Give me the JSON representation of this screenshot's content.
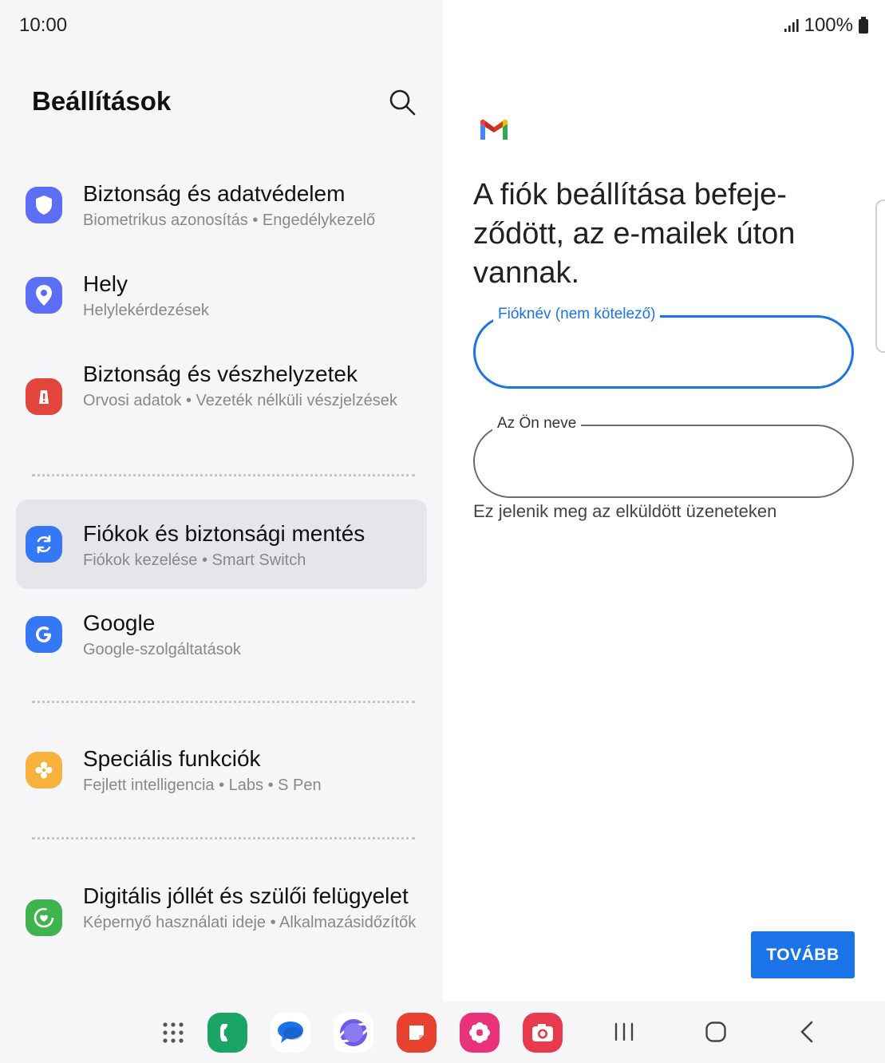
{
  "status": {
    "time": "10:00",
    "battery": "100%",
    "signal_icon": "signal-bars-icon",
    "battery_icon": "battery-full-icon"
  },
  "settings": {
    "title": "Beállítások",
    "search_icon": "search-icon",
    "items": [
      {
        "name": "Biztonság és adatvédelem",
        "sub": "Biometrikus azonosítás  •  Engedélykezelő",
        "icon": "shield-icon",
        "color": "#5b6ef5"
      },
      {
        "name": "Hely",
        "sub": "Helylekérdezések",
        "icon": "location-pin-icon",
        "color": "#5b6ef5"
      },
      {
        "name": "Biztonság és vészhelyzetek",
        "sub": "Orvosi adatok  •  Vezeték nélküli vészjelzések",
        "icon": "emergency-alert-icon",
        "color": "#e2453c"
      },
      {
        "name": "Fiókok és biztonsági mentés",
        "sub": "Fiókok kezelése  •  Smart Switch",
        "icon": "sync-icon",
        "color": "#3478f6"
      },
      {
        "name": "Google",
        "sub": "Google-szolgáltatások",
        "icon": "google-g-icon",
        "color": "#3478f6"
      },
      {
        "name": "Speciális funkciók",
        "sub": "Fejlett intelligencia  •  Labs  •  S Pen",
        "icon": "gear-flower-icon",
        "color": "#f6b23c"
      },
      {
        "name": "Digitális jóllét és szülői felügyelet",
        "sub": "Képernyő használati ideje  •  Alkalmazásidőzítők",
        "icon": "wellbeing-heart-icon",
        "color": "#3fb44e"
      }
    ]
  },
  "account_setup": {
    "logo": "gmail-logo-icon",
    "headline": "A fiók beállítása befeje-ződött, az e-mailek úton vannak.",
    "account_name_label": "Fióknév (nem kötelező)",
    "account_name_value": "",
    "your_name_label": "Az Ön neve",
    "your_name_value": "",
    "helper_text": "Ez jelenik meg az elküldött üzeneteken",
    "next_button": "TOVÁBB"
  },
  "taskbar": {
    "apps": [
      {
        "name": "app-drawer-icon",
        "color": "#555555"
      },
      {
        "name": "phone-app-icon",
        "color": "#1aa566"
      },
      {
        "name": "messages-app-icon",
        "color": "#1a73e8"
      },
      {
        "name": "internet-app-icon",
        "color": "#6c5ce7"
      },
      {
        "name": "notes-app-icon",
        "color": "#e8412f"
      },
      {
        "name": "gallery-app-icon",
        "color": "#e8337a"
      },
      {
        "name": "camera-app-icon",
        "color": "#e83a4f"
      }
    ],
    "nav": [
      "recents-icon",
      "home-icon",
      "back-icon"
    ]
  }
}
